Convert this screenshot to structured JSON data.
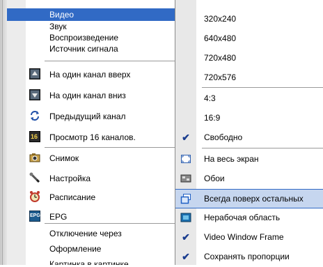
{
  "main_menu": {
    "items": [
      {
        "label": "Видео",
        "has_submenu": true,
        "highlighted": true
      },
      {
        "label": "Звук",
        "has_submenu": true
      },
      {
        "label": "Воспроизведение",
        "has_submenu": true
      },
      {
        "label": "Источник сигнала",
        "has_submenu": true
      },
      {
        "label": "На один канал вверх",
        "icon": "channel-up-icon"
      },
      {
        "label": "На один канал вниз",
        "icon": "channel-down-icon"
      },
      {
        "label": "Предыдущий канал",
        "icon": "previous-channel-icon"
      },
      {
        "label": "Просмотр 16 каналов.",
        "icon": "sixteen-channels-icon",
        "icon_text": "16"
      },
      {
        "label": "Снимок",
        "icon": "camera-icon"
      },
      {
        "label": "Настройка",
        "icon": "settings-tool-icon"
      },
      {
        "label": "Расписание",
        "icon": "alarm-clock-icon"
      },
      {
        "label": "EPG",
        "icon": "epg-icon",
        "icon_text": "EPG"
      },
      {
        "label": "Отключение через",
        "has_submenu": true
      },
      {
        "label": "Оформление",
        "has_submenu": true
      },
      {
        "label": "Картинка в картинке",
        "has_submenu": true
      }
    ]
  },
  "video_submenu": {
    "items": [
      {
        "label": "320x240"
      },
      {
        "label": "640x480"
      },
      {
        "label": "720x480"
      },
      {
        "label": "720x576"
      },
      {
        "label": "4:3"
      },
      {
        "label": "16:9"
      },
      {
        "label": "Свободно",
        "checked": true
      },
      {
        "label": "На весь экран",
        "icon": "fullscreen-icon"
      },
      {
        "label": "Обои",
        "icon": "wallpaper-icon"
      },
      {
        "label": "Всегда поверх остальных",
        "icon": "always-on-top-icon",
        "highlighted": true
      },
      {
        "label": "Нерабочая область",
        "icon": "non-client-area-icon"
      },
      {
        "label": "Video Window Frame",
        "checked": true
      },
      {
        "label": "Сохранять пропорции",
        "checked": true
      }
    ]
  },
  "colors": {
    "highlight": "#316ac5",
    "submenu_hover": "#c6d6ef"
  },
  "check_glyph": "✔"
}
